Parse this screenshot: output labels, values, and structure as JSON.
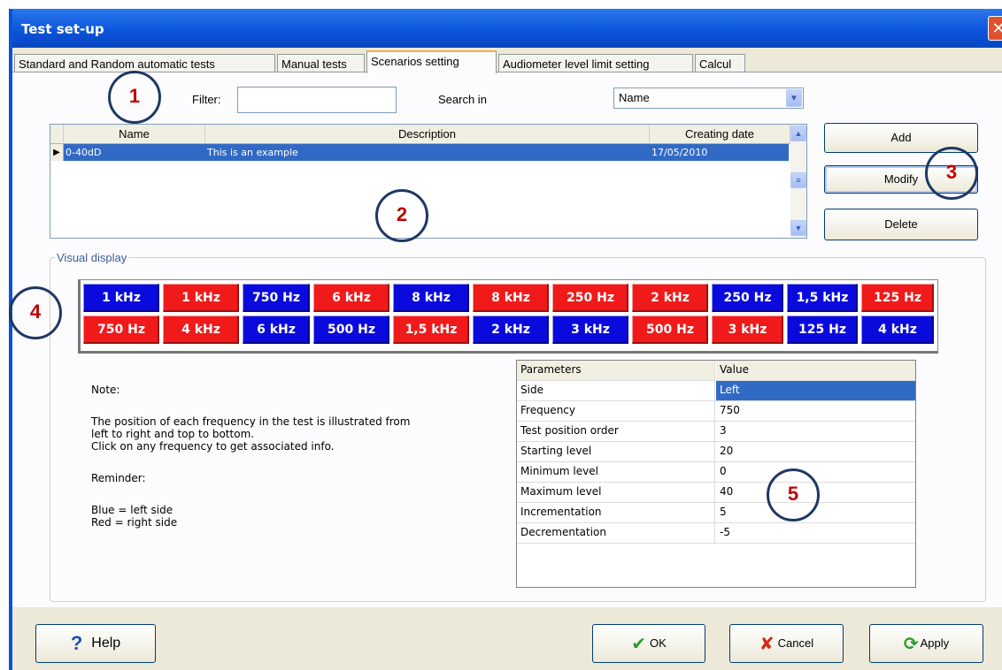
{
  "window": {
    "title": "Test set-up",
    "close_glyph": "✕"
  },
  "tabs": [
    {
      "label": "Standard and Random automatic tests"
    },
    {
      "label": "Manual tests"
    },
    {
      "label": "Scenarios setting"
    },
    {
      "label": "Audiometer level limit setting"
    },
    {
      "label": "Calcul"
    }
  ],
  "filter": {
    "label": "Filter:",
    "value": ""
  },
  "search": {
    "label": "Search in",
    "value": "Name"
  },
  "scenarios_grid": {
    "columns": [
      "Name",
      "Description",
      "Creating date"
    ],
    "rows": [
      {
        "name": "0-40dD",
        "description": "This is an example",
        "date": "17/05/2010"
      }
    ]
  },
  "actions": {
    "add": "Add",
    "modify": "Modify",
    "delete": "Delete"
  },
  "visual_display": {
    "legend": "Visual display",
    "row1": [
      {
        "label": "1 kHz",
        "side": "left"
      },
      {
        "label": "1 kHz",
        "side": "right"
      },
      {
        "label": "750 Hz",
        "side": "left"
      },
      {
        "label": "6 kHz",
        "side": "right"
      },
      {
        "label": "8 kHz",
        "side": "left"
      },
      {
        "label": "8 kHz",
        "side": "right"
      },
      {
        "label": "250 Hz",
        "side": "right"
      },
      {
        "label": "2 kHz",
        "side": "right"
      },
      {
        "label": "250 Hz",
        "side": "left"
      },
      {
        "label": "1,5 kHz",
        "side": "left"
      },
      {
        "label": "125 Hz",
        "side": "right"
      }
    ],
    "row2": [
      {
        "label": "750 Hz",
        "side": "right"
      },
      {
        "label": "4 kHz",
        "side": "right"
      },
      {
        "label": "6 kHz",
        "side": "left"
      },
      {
        "label": "500 Hz",
        "side": "left"
      },
      {
        "label": "1,5 kHz",
        "side": "right"
      },
      {
        "label": "2 kHz",
        "side": "left"
      },
      {
        "label": "3 kHz",
        "side": "left"
      },
      {
        "label": "500 Hz",
        "side": "right"
      },
      {
        "label": "3 kHz",
        "side": "right"
      },
      {
        "label": "125 Hz",
        "side": "left"
      },
      {
        "label": "4 kHz",
        "side": "left"
      }
    ]
  },
  "colors": {
    "left": "#0a0adc",
    "right": "#f01a1a",
    "selection": "#316ac5",
    "annotation": "#c00000"
  },
  "note": {
    "title": "Note:",
    "line1": "The position of each frequency in the test is illustrated from",
    "line2": "left to right and top to bottom.",
    "line3": "Click on any frequency to get associated info.",
    "reminder": "Reminder:",
    "blue": "Blue = left side",
    "red": "Red = right side"
  },
  "parameters": {
    "header": {
      "key": "Parameters",
      "value": "Value"
    },
    "rows": [
      {
        "key": "Side",
        "value": "Left"
      },
      {
        "key": "Frequency",
        "value": "750"
      },
      {
        "key": "Test position order",
        "value": "3"
      },
      {
        "key": "Starting level",
        "value": "20"
      },
      {
        "key": "Minimum level",
        "value": "0"
      },
      {
        "key": "Maximum level",
        "value": "40"
      },
      {
        "key": "Incrementation",
        "value": "5"
      },
      {
        "key": "Decrementation",
        "value": "-5"
      }
    ]
  },
  "annotations": [
    "1",
    "2",
    "3",
    "4",
    "5"
  ],
  "footer": {
    "help": "Help",
    "ok": "OK",
    "cancel": "Cancel",
    "apply": "Apply"
  }
}
